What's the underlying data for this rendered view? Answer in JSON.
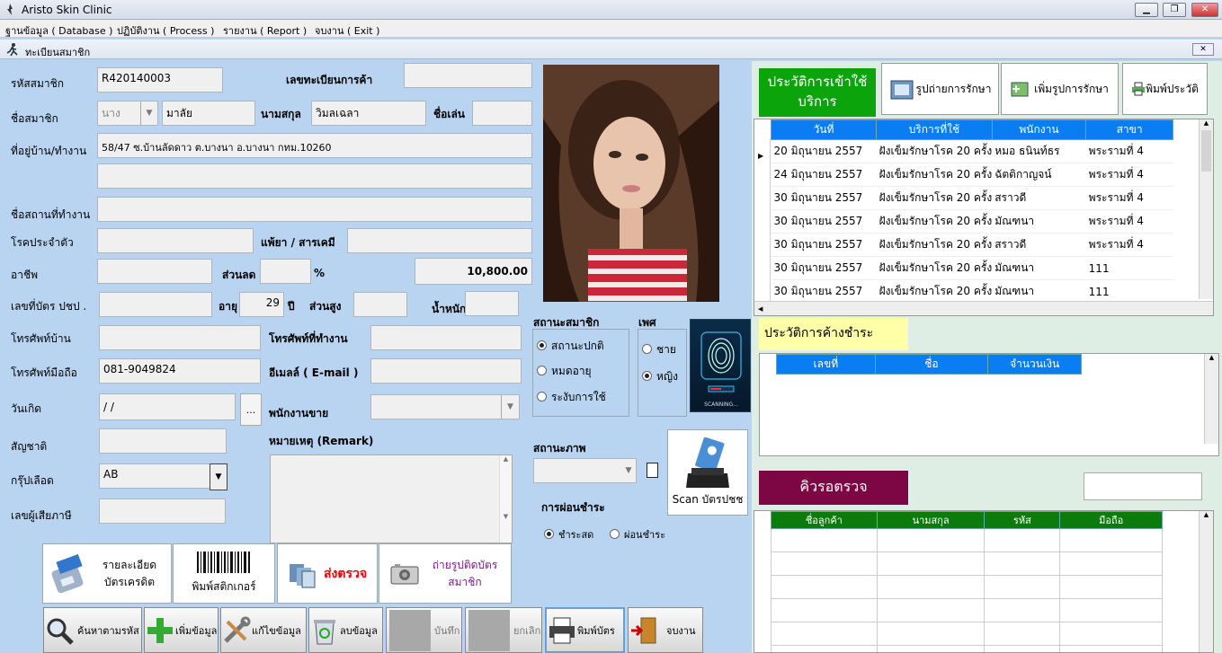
{
  "window": {
    "title": "Aristo Skin Clinic"
  },
  "menu": [
    "ฐานข้อมูล ( Database )",
    "ปฏิบัติงาน ( Process )",
    "รายงาน ( Report )",
    "จบงาน ( Exit )"
  ],
  "form": {
    "title": "ทะเบียนสมาชิก",
    "labels": {
      "member_code": "รหัสสมาชิก",
      "trade_reg": "เลขทะเบียนการค้า",
      "member_name": "ชื่อสมาชิก",
      "surname": "นามสกุล",
      "nickname": "ชื่อเล่น",
      "address": "ที่อยู่บ้าน/ทำงาน",
      "workplace": "ชื่อสถานที่ทำงาน",
      "disease": "โรคประจำตัว",
      "allergy": "แพ้ยา / สารเคมี",
      "occupation": "อาชีพ",
      "discount": "ส่วนลด",
      "percent": "%",
      "id_card": "เลขที่บัตร ปชป .",
      "age": "อายุ",
      "years": "ปี",
      "height": "ส่วนสูง",
      "weight": "น้ำหนัก",
      "home_phone": "โทรศัพท์บ้าน",
      "work_phone": "โทรศัพท์ที่ทำงาน",
      "mobile": "โทรศัพท์มือถือ",
      "email": "อีเมลล์ ( E-mail )",
      "birthday": "วันเกิด",
      "salesperson": "พนักงานขาย",
      "nationality": "สัญชาติ",
      "remark": "หมายเหตุ (Remark)",
      "blood": "กรุ๊ปเลือด",
      "tax_id": "เลขผู้เสียภาษี",
      "member_status": "สถานะสมาชิก",
      "gender": "เพศ",
      "condition": "สถานะภาพ",
      "payment": "การผ่อนชำระ"
    },
    "values": {
      "member_code": "R420140003",
      "prefix": "นาง",
      "first_name": "มาลัย",
      "surname": "วิมลเฉลา",
      "address1": "58/47 ซ.บ้านลัดดาว ต.บางนา อ.บางนา กทม.10260",
      "amount": "10,800.00",
      "age": "29",
      "mobile": "081-9049824",
      "birthday": " /  /",
      "blood": "AB",
      "date_btn": "..."
    },
    "status_options": [
      "สถานะปกติ",
      "หมดอายุ",
      "ระงับการใช้"
    ],
    "gender_options": [
      "ชาย",
      "หญิง"
    ],
    "payment_options": [
      "ชำระสด",
      "ผ่อนชำระ"
    ],
    "scan_label": "Scan บัตรปชช",
    "scanning": "SCANNING..."
  },
  "actions": {
    "credit": "รายละเอียดบัตรเครดิต",
    "sticker": "พิมพ์สติกเกอร์",
    "send_exam": "ส่งตรวจ",
    "photo_card": "ถ่ายรูปติดบัตรสมาชิก"
  },
  "toolbar": {
    "search": "ค้นหาตามรหัส",
    "add": "เพิ่มข้อมูล",
    "edit": "แก้ไขข้อมูล",
    "delete": "ลบข้อมูล",
    "save": "บันทึก",
    "cancel": "ยกเลิก",
    "print_card": "พิมพ์บัตร",
    "exit": "จบงาน"
  },
  "history": {
    "title": "ประวัติการเข้าใช้บริการ",
    "btn_photos": "รูปถ่ายการรักษา",
    "btn_add_photo": "เพิ่มรูปการรักษา",
    "btn_print": "พิมพ์ประวัติ",
    "columns": [
      "วันที่",
      "บริการที่ใช้",
      "พนักงาน",
      "สาขา"
    ],
    "rows": [
      [
        "20 มิถุนายน 2557",
        "ฝังเข็มรักษาโรค 20 ครั้ง",
        "หมอ ธนินท์ธร",
        "พระรามที่ 4"
      ],
      [
        "24 มิถุนายน 2557",
        "ฝังเข็มรักษาโรค 20 ครั้ง",
        "ฉัตติกาญจน์",
        "พระรามที่ 4"
      ],
      [
        "30 มิถุนายน 2557",
        "ฝังเข็มรักษาโรค 20 ครั้ง",
        "สราวดี",
        "พระรามที่ 4"
      ],
      [
        "30 มิถุนายน 2557",
        "ฝังเข็มรักษาโรค 20 ครั้ง",
        "มัณฑนา",
        "พระรามที่ 4"
      ],
      [
        "30 มิถุนายน 2557",
        "ฝังเข็มรักษาโรค 20 ครั้ง",
        "สราวดี",
        "พระรามที่ 4"
      ],
      [
        "30 มิถุนายน 2557",
        "ฝังเข็มรักษาโรค 20 ครั้ง",
        "มัณฑนา",
        "111"
      ],
      [
        "30 มิถุนายน 2557",
        "ฝังเข็มรักษาโรค 20 ครั้ง",
        "มัณฑนา",
        "111"
      ]
    ]
  },
  "debt": {
    "title": "ประวัติการค้างชำระ",
    "columns": [
      "เลขที่",
      "ชื่อ",
      "จำนวนเงิน"
    ]
  },
  "queue": {
    "title": "คิวรอตรวจ",
    "columns": [
      "ชื่อลูกค้า",
      "นามสกุล",
      "รหัส",
      "มือถือ"
    ]
  }
}
